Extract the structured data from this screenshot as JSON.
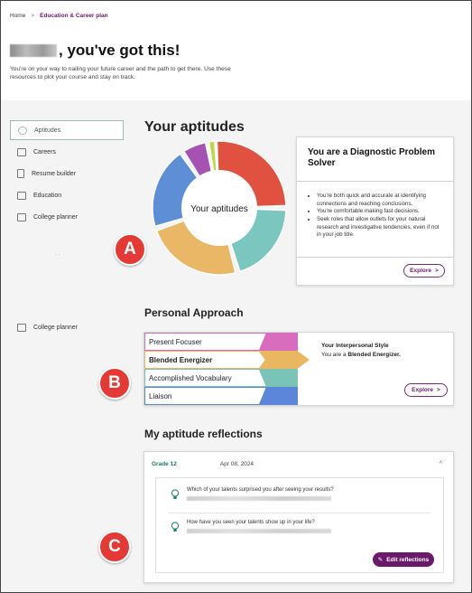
{
  "breadcrumb": {
    "home": "Home",
    "separator": ">",
    "current": "Education & Career plan"
  },
  "hero": {
    "title_suffix": ", you've got this!",
    "subtitle": "You're on your way to nailing your future career and the path to get there. Use these resources to plot your course and stay on track."
  },
  "sidebar": {
    "items": [
      {
        "label": "Aptitudes",
        "icon": "aptitudes-icon"
      },
      {
        "label": "Careers",
        "icon": "briefcase-icon"
      },
      {
        "label": "Resume builder",
        "icon": "document-icon"
      },
      {
        "label": "Education",
        "icon": "graduation-cap-icon"
      },
      {
        "label": "College planner",
        "icon": "graduation-cap-icon"
      }
    ],
    "dots": "·  ·",
    "extra": {
      "label": "College planner",
      "icon": "graduation-cap-icon"
    }
  },
  "aptitudes": {
    "title": "Your aptitudes",
    "donut_label": "Your aptitudes",
    "colors": [
      "#e0523f",
      "#7cc6c0",
      "#eab766",
      "#5e8fd6",
      "#a552b2",
      "#bcd94a"
    ]
  },
  "aptitude_card": {
    "title": "You are a Diagnostic Problem Solver",
    "bullets": [
      "You're both quick and accurate at identifying connections and reaching conclusions.",
      "You're comfortable making fast decisions.",
      "Seek roles that allow outlets for your natural research and investigative tendencies, even if not in your job title."
    ],
    "explore_label": "Explore",
    "explore_chevron": ">"
  },
  "approach": {
    "title": "Personal Approach",
    "rows": [
      {
        "label": "Present Focuser",
        "color": "#d96dbd",
        "selected": false
      },
      {
        "label": "Blended Energizer",
        "color": "#e8b75f",
        "selected": true
      },
      {
        "label": "Accomplished Vocabulary",
        "color": "#79c4b7",
        "selected": false
      },
      {
        "label": "Liaison",
        "color": "#5b86d9",
        "selected": false
      }
    ],
    "style_title": "Your Interpersonal Style",
    "style_prefix": "You are a ",
    "style_value": "Blended Energizer.",
    "explore_label": "Explore",
    "explore_chevron": ">"
  },
  "reflections": {
    "title": "My aptitude reflections",
    "grade": "Grade 12",
    "date": "Apr 08, 2024",
    "chevron": "^",
    "questions": [
      "Which of your talents surprised you after seeing your results?",
      "How have you seen your talents show up in your life?"
    ],
    "edit_label": "Edit reflections"
  },
  "markers": [
    "A",
    "B",
    "C"
  ]
}
